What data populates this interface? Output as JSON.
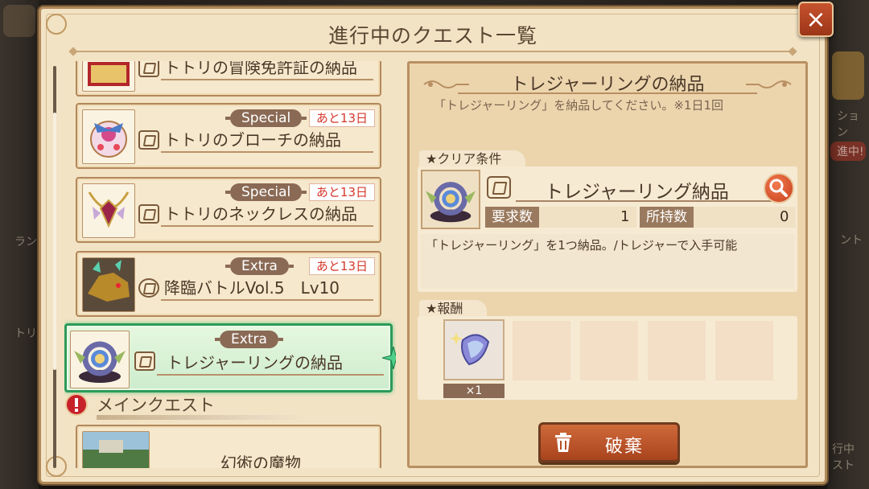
{
  "dialog": {
    "title": "進行中のクエスト一覧",
    "close_label": "×"
  },
  "quest_list": [
    {
      "name": "トトリの冒険免許証の納品",
      "tag": "",
      "days": ""
    },
    {
      "name": "トトリのブローチの納品",
      "tag": "Special",
      "days": "あと13日"
    },
    {
      "name": "トトリのネックレスの納品",
      "tag": "Special",
      "days": "あと13日"
    },
    {
      "name": "降臨バトルVol.5　Lv10",
      "tag": "Extra",
      "days": "あと13日"
    },
    {
      "name": "トレジャーリングの納品",
      "tag": "Extra",
      "days": "",
      "selected": true
    }
  ],
  "main_quest": {
    "section_label": "メインクエスト",
    "item_name": "幻術の魔物"
  },
  "detail": {
    "title": "トレジャーリングの納品",
    "description": "「トレジャーリング」を納品してください。※1日1回",
    "clear_section": "★クリア条件",
    "condition_name": "トレジャーリング納品",
    "required_label": "要求数",
    "required_value": "1",
    "owned_label": "所持数",
    "owned_value": "0",
    "condition_text": "「トレジャーリング」を1つ納品。/トレジャーで入手可能",
    "reward_section": "★報酬",
    "reward_qty": "×1",
    "discard_label": "破棄"
  },
  "background": {
    "right_label_1": "ション",
    "right_label_2": "進中!",
    "right_label_3": "ント",
    "right_label_4": "行中",
    "right_label_5": "スト",
    "left_label_1": "ラン",
    "left_label_2": "トリ"
  },
  "colors": {
    "panel": "#f2e3c4",
    "selected_border": "#2d9a5a",
    "tag": "#8a6a55",
    "days_text": "#d6372b",
    "discard": "#b84e25"
  }
}
